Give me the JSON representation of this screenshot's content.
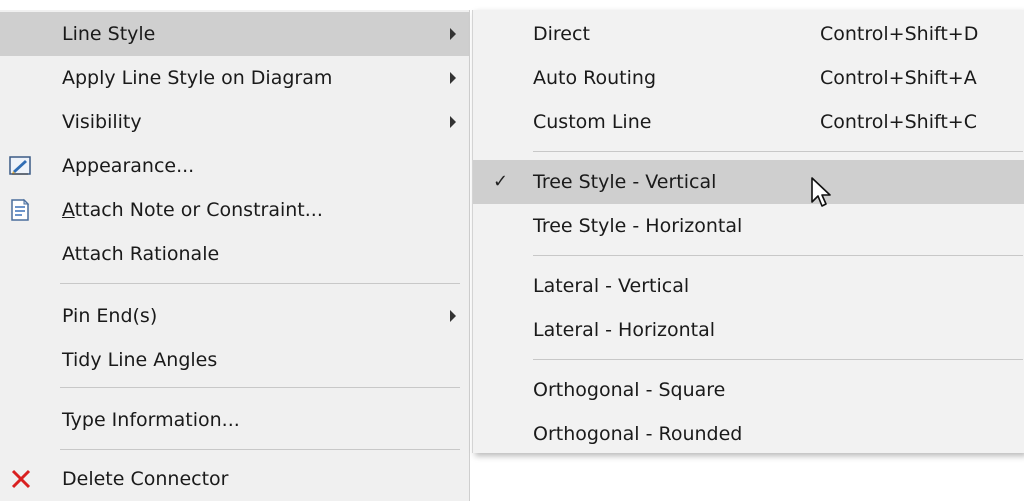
{
  "main_menu": {
    "items": [
      {
        "label": "Line Style"
      },
      {
        "label": "Apply Line Style on Diagram"
      },
      {
        "label": "Visibility"
      },
      {
        "label": "Appearance..."
      },
      {
        "label_prefix": "A",
        "label_rest": "ttach Note or Constraint..."
      },
      {
        "label": "Attach Rationale"
      },
      {
        "label": "Pin End(s)"
      },
      {
        "label": "Tidy Line Angles"
      },
      {
        "label": "Type Information..."
      },
      {
        "label": "Delete Connector"
      }
    ]
  },
  "sub_menu": {
    "items": [
      {
        "label": "Direct",
        "shortcut": "Control+Shift+D"
      },
      {
        "label": "Auto Routing",
        "shortcut": "Control+Shift+A"
      },
      {
        "label": "Custom Line",
        "shortcut": "Control+Shift+C"
      },
      {
        "label": "Tree Style - Vertical",
        "checked": true
      },
      {
        "label": "Tree Style - Horizontal"
      },
      {
        "label": "Lateral - Vertical"
      },
      {
        "label": "Lateral - Horizontal"
      },
      {
        "label": "Orthogonal - Square"
      },
      {
        "label": "Orthogonal - Rounded"
      }
    ]
  },
  "icons": {
    "appearance": "appearance-icon",
    "note": "note-icon",
    "delete": "delete-icon",
    "check": "checkmark-icon",
    "cursor": "mouse-pointer-icon"
  },
  "colors": {
    "highlight": "#cfcfcf",
    "menu_bg": "#f0f0f0",
    "delete_red": "#d92020"
  }
}
